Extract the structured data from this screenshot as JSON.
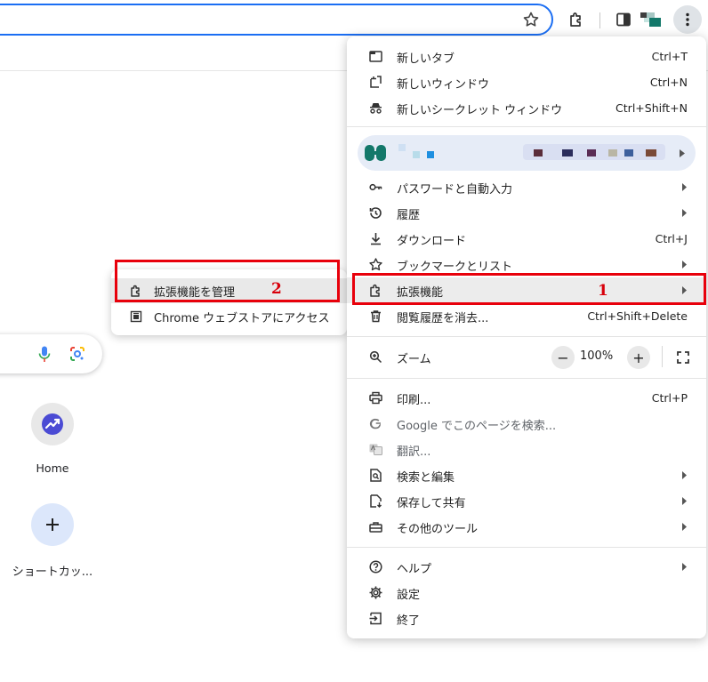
{
  "menu": {
    "group1": [
      {
        "label": "新しいタブ",
        "shortcut": "Ctrl+T",
        "icon": "new-tab-icon"
      },
      {
        "label": "新しいウィンドウ",
        "shortcut": "Ctrl+N",
        "icon": "new-window-icon"
      },
      {
        "label": "新しいシークレット ウィンドウ",
        "shortcut": "Ctrl+Shift+N",
        "icon": "incognito-icon"
      }
    ],
    "group2": [
      {
        "label": "パスワードと自動入力",
        "icon": "key-icon"
      },
      {
        "label": "履歴",
        "icon": "history-icon"
      },
      {
        "label": "ダウンロード",
        "shortcut": "Ctrl+J",
        "icon": "download-icon"
      },
      {
        "label": "ブックマークとリスト",
        "icon": "star-icon"
      },
      {
        "label": "拡張機能",
        "icon": "puzzle-icon"
      },
      {
        "label": "閲覧履歴を消去...",
        "shortcut": "Ctrl+Shift+Delete",
        "icon": "trash-icon"
      }
    ],
    "zoom": {
      "label": "ズーム",
      "value": "100%",
      "minus": "−",
      "plus": "+"
    },
    "group3": [
      {
        "label": "印刷...",
        "shortcut": "Ctrl+P",
        "icon": "print-icon"
      },
      {
        "label": "Google でこのページを検索...",
        "icon": "google-icon"
      },
      {
        "label": "翻訳...",
        "icon": "translate-icon"
      },
      {
        "label": "検索と編集",
        "icon": "search-doc-icon"
      },
      {
        "label": "保存して共有",
        "icon": "save-share-icon"
      },
      {
        "label": "その他のツール",
        "icon": "toolbox-icon"
      }
    ],
    "group4": [
      {
        "label": "ヘルプ",
        "icon": "help-icon"
      },
      {
        "label": "設定",
        "icon": "gear-icon"
      },
      {
        "label": "終了",
        "icon": "exit-icon"
      }
    ]
  },
  "submenu": [
    {
      "label": "拡張機能を管理",
      "icon": "puzzle-icon"
    },
    {
      "label": "Chrome ウェブストアにアクセス",
      "icon": "webstore-icon"
    }
  ],
  "ntp": {
    "tiles": [
      {
        "label": "Home",
        "icon": "trend-icon"
      },
      {
        "label": "ショートカッ...",
        "icon": "plus-icon"
      }
    ]
  },
  "annotations": {
    "marker1": "1",
    "marker2": "2"
  },
  "colors": {
    "annotation_red": "#e8000b",
    "focus_blue": "#1b6ef3",
    "menu_highlight": "#ececec"
  }
}
